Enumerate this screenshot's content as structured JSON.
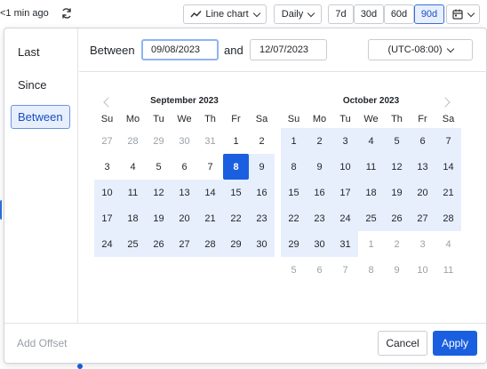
{
  "toolbar": {
    "updated_text": "<1 min ago",
    "chart_type": "Line chart",
    "interval": "Daily",
    "ranges": [
      "7d",
      "30d",
      "60d",
      "90d"
    ],
    "active_range": "90d",
    "colors": {
      "accent": "#1a5fe0",
      "active_bg": "#e7effd"
    }
  },
  "sidebar": {
    "items": [
      {
        "label": "Last"
      },
      {
        "label": "Since"
      },
      {
        "label": "Between"
      }
    ],
    "active": "Between"
  },
  "range": {
    "between_label": "Between",
    "start_value": "09/08/2023",
    "and_label": "and",
    "end_value": "12/07/2023",
    "timezone": "(UTC-08:00)"
  },
  "calendar": {
    "weekday_labels": [
      "Su",
      "Mo",
      "Tu",
      "We",
      "Th",
      "Fr",
      "Sa"
    ],
    "months": [
      {
        "title": "September 2023",
        "weeks": [
          [
            {
              "d": "27",
              "s": "out"
            },
            {
              "d": "28",
              "s": "out"
            },
            {
              "d": "29",
              "s": "out"
            },
            {
              "d": "30",
              "s": "out"
            },
            {
              "d": "31",
              "s": "out"
            },
            {
              "d": "1",
              "s": ""
            },
            {
              "d": "2",
              "s": ""
            }
          ],
          [
            {
              "d": "3",
              "s": ""
            },
            {
              "d": "4",
              "s": ""
            },
            {
              "d": "5",
              "s": ""
            },
            {
              "d": "6",
              "s": ""
            },
            {
              "d": "7",
              "s": ""
            },
            {
              "d": "8",
              "s": "sel"
            },
            {
              "d": "9",
              "s": "range"
            }
          ],
          [
            {
              "d": "10",
              "s": "range"
            },
            {
              "d": "11",
              "s": "range"
            },
            {
              "d": "12",
              "s": "range"
            },
            {
              "d": "13",
              "s": "range"
            },
            {
              "d": "14",
              "s": "range"
            },
            {
              "d": "15",
              "s": "range"
            },
            {
              "d": "16",
              "s": "range"
            }
          ],
          [
            {
              "d": "17",
              "s": "range"
            },
            {
              "d": "18",
              "s": "range"
            },
            {
              "d": "19",
              "s": "range"
            },
            {
              "d": "20",
              "s": "range"
            },
            {
              "d": "21",
              "s": "range"
            },
            {
              "d": "22",
              "s": "range"
            },
            {
              "d": "23",
              "s": "range"
            }
          ],
          [
            {
              "d": "24",
              "s": "range"
            },
            {
              "d": "25",
              "s": "range"
            },
            {
              "d": "26",
              "s": "range"
            },
            {
              "d": "27",
              "s": "range"
            },
            {
              "d": "28",
              "s": "range"
            },
            {
              "d": "29",
              "s": "range"
            },
            {
              "d": "30",
              "s": "range"
            }
          ]
        ]
      },
      {
        "title": "October 2023",
        "weeks": [
          [
            {
              "d": "1",
              "s": "range"
            },
            {
              "d": "2",
              "s": "range"
            },
            {
              "d": "3",
              "s": "range"
            },
            {
              "d": "4",
              "s": "range"
            },
            {
              "d": "5",
              "s": "range"
            },
            {
              "d": "6",
              "s": "range"
            },
            {
              "d": "7",
              "s": "range"
            }
          ],
          [
            {
              "d": "8",
              "s": "range"
            },
            {
              "d": "9",
              "s": "range"
            },
            {
              "d": "10",
              "s": "range"
            },
            {
              "d": "11",
              "s": "range"
            },
            {
              "d": "12",
              "s": "range"
            },
            {
              "d": "13",
              "s": "range"
            },
            {
              "d": "14",
              "s": "range"
            }
          ],
          [
            {
              "d": "15",
              "s": "range"
            },
            {
              "d": "16",
              "s": "range"
            },
            {
              "d": "17",
              "s": "range"
            },
            {
              "d": "18",
              "s": "range"
            },
            {
              "d": "19",
              "s": "range"
            },
            {
              "d": "20",
              "s": "range"
            },
            {
              "d": "21",
              "s": "range"
            }
          ],
          [
            {
              "d": "22",
              "s": "range"
            },
            {
              "d": "23",
              "s": "range"
            },
            {
              "d": "24",
              "s": "range"
            },
            {
              "d": "25",
              "s": "range"
            },
            {
              "d": "26",
              "s": "range"
            },
            {
              "d": "27",
              "s": "range"
            },
            {
              "d": "28",
              "s": "range"
            }
          ],
          [
            {
              "d": "29",
              "s": "range"
            },
            {
              "d": "30",
              "s": "range"
            },
            {
              "d": "31",
              "s": "range"
            },
            {
              "d": "1",
              "s": "out"
            },
            {
              "d": "2",
              "s": "out"
            },
            {
              "d": "3",
              "s": "out"
            },
            {
              "d": "4",
              "s": "out"
            }
          ],
          [
            {
              "d": "5",
              "s": "out"
            },
            {
              "d": "6",
              "s": "out"
            },
            {
              "d": "7",
              "s": "out"
            },
            {
              "d": "8",
              "s": "out"
            },
            {
              "d": "9",
              "s": "out"
            },
            {
              "d": "10",
              "s": "out"
            },
            {
              "d": "11",
              "s": "out"
            }
          ]
        ]
      }
    ]
  },
  "footer": {
    "add_offset": "Add Offset",
    "cancel": "Cancel",
    "apply": "Apply"
  }
}
